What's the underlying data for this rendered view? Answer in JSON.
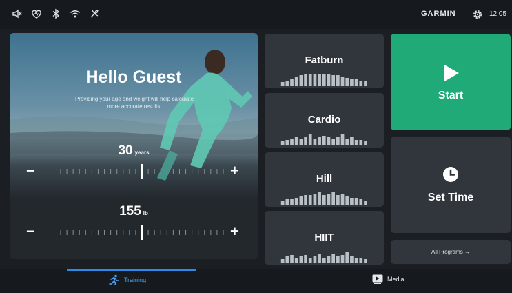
{
  "status": {
    "icons": [
      "volume-icon",
      "heart-icon",
      "bluetooth-icon",
      "wifi-icon",
      "gear-connect-icon"
    ],
    "brand": "GARMIN",
    "time": "12:05"
  },
  "profile": {
    "greeting": "Hello Guest",
    "subtitle": "Providing your age and weight will help calculate more accurate results.",
    "age": {
      "value": "30",
      "unit": "years",
      "level": 0.5
    },
    "weight": {
      "value": "155",
      "unit": "lb",
      "level": 0.5
    },
    "minus_label": "−",
    "plus_label": "+"
  },
  "programs": [
    {
      "name": "Fatburn",
      "bars": [
        3,
        4,
        5,
        7,
        8,
        9,
        9,
        9,
        9,
        9,
        9,
        8,
        8,
        7,
        6,
        5,
        5,
        4,
        4
      ]
    },
    {
      "name": "Cardio",
      "bars": [
        3,
        4,
        5,
        6,
        5,
        6,
        8,
        5,
        6,
        7,
        6,
        5,
        6,
        8,
        5,
        6,
        4,
        4,
        3
      ]
    },
    {
      "name": "Hill",
      "bars": [
        3,
        4,
        4,
        5,
        6,
        7,
        7,
        8,
        9,
        7,
        8,
        9,
        7,
        8,
        6,
        5,
        5,
        4,
        3
      ]
    },
    {
      "name": "HIIT",
      "bars": [
        3,
        5,
        6,
        4,
        5,
        6,
        4,
        5,
        7,
        4,
        5,
        7,
        5,
        6,
        8,
        5,
        4,
        4,
        3
      ]
    }
  ],
  "start_label": "Start",
  "settime_label": "Set Time",
  "all_programs_label": "All Programs →",
  "tabs": {
    "training": "Training",
    "media": "Media"
  },
  "colors": {
    "accent_green": "#1faa78",
    "accent_blue": "#2a8ce6",
    "card": "#30363c"
  }
}
